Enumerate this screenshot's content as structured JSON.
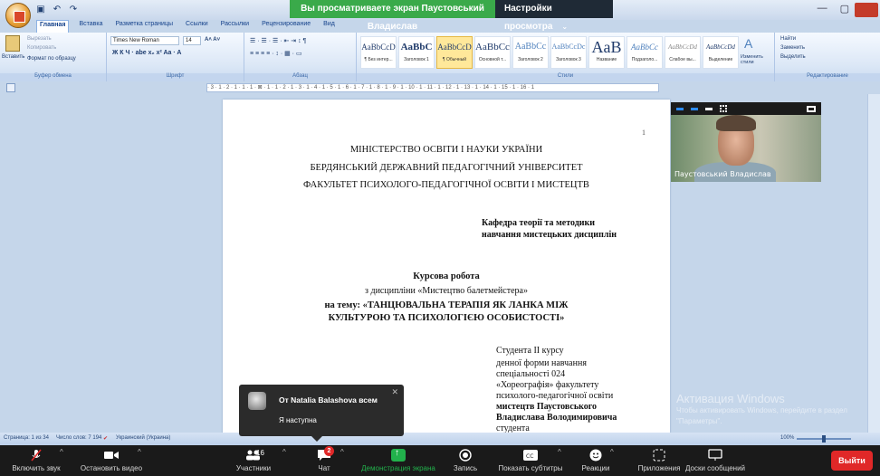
{
  "zoom_banner": {
    "sharing_text": "Вы просматриваете экран Паустовський Владислав",
    "view_options": "Настройки просмотра"
  },
  "word": {
    "qat_icons": [
      "save-icon",
      "undo-icon",
      "redo-icon"
    ],
    "tabs": [
      "Главная",
      "Вставка",
      "Разметка страницы",
      "Ссылки",
      "Рассылки",
      "Рецензирование",
      "Вид"
    ],
    "active_tab": "Главная",
    "clipboard": {
      "paste": "Вставить",
      "cut": "Вырезать",
      "copy": "Копировать",
      "format_painter": "Формат по образцу",
      "group_label": "Буфер обмена"
    },
    "font": {
      "name": "Times New Roman",
      "size": "14",
      "group_label": "Шрифт"
    },
    "paragraph": {
      "group_label": "Абзац"
    },
    "styles": {
      "group_label": "Стили",
      "items": [
        {
          "sample": "AaBbCcD",
          "name": "¶ Без интер..."
        },
        {
          "sample": "AaBbC",
          "name": "Заголовок 1"
        },
        {
          "sample": "AaBbCcD",
          "name": "¶ Обычный",
          "selected": true
        },
        {
          "sample": "AaBbCc",
          "name": "Основной т..."
        },
        {
          "sample": "AaBbCc",
          "name": "Заголовок 2"
        },
        {
          "sample": "AaBbCcDc",
          "name": "Заголовок 3"
        },
        {
          "sample": "AaB",
          "name": "Название"
        },
        {
          "sample": "AaBbCc",
          "name": "Подзаголо..."
        },
        {
          "sample": "AaBbCcDd",
          "name": "Слабое вы..."
        },
        {
          "sample": "AaBbCcDd",
          "name": "Выделение"
        }
      ],
      "change_styles": "Изменить стили"
    },
    "editing": {
      "find": "Найти",
      "replace": "Заменить",
      "select": "Выделить",
      "group_label": "Редактирование"
    },
    "ruler_text": "· 3 · 1 · 2 · 1 · 1 · 1 · ⊠ · 1 · 1 · 2 · 1 · 3 · 1 · 4 · 1 · 5 · 1 · 6 · 1 · 7 · 1 · 8 · 1 · 9 · 1 · 10 · 1 · 11 · 1 · 12 · 1 · 13 · 1 · 14 · 1 · 15 · 1 · 16 · 1",
    "statusbar": {
      "page": "Страница: 1 из 34",
      "words": "Число слов: 7 194",
      "language": "Украинский (Украина)",
      "zoom": "100%"
    }
  },
  "document": {
    "page_number": "1",
    "ministry": "МІНІСТЕРСТВО ОСВІТИ І НАУКИ УКРАЇНИ",
    "university": "БЕРДЯНСЬКИЙ ДЕРЖАВНИЙ ПЕДАГОГІЧНИЙ УНІВЕРСИТЕТ",
    "faculty": "ФАКУЛЬТЕТ ПСИХОЛОГО-ПЕДАГОГІЧНОЇ ОСВІТИ І МИСТЕЦТВ",
    "department_line1": "Кафедра теорії та методики",
    "department_line2": "навчання мистецьких дисциплін",
    "work_type": "Курсова робота",
    "discipline": "з дисципліни «Мистецтво балетмейстера»",
    "topic_line1": "на тему: «ТАНЦЮВАЛЬНА ТЕРАПІЯ ЯК ЛАНКА МІЖ",
    "topic_line2": "КУЛЬТУРОЮ ТА ПСИХОЛОГІЄЮ ОСОБИСТОСТІ»",
    "student": [
      "Студента ІІ курсу",
      "денної форми навчання",
      "спеціальності 024",
      "«Хореографія» факультету",
      "психолого-педагогічної освіти",
      "мистецтв Паустовського",
      "Владислава Володимировича",
      "студента"
    ]
  },
  "participant_video": {
    "name": "Паустовський Владислав"
  },
  "chat_popup": {
    "from": "От Natalia Balashova всем",
    "message": "Я наступна"
  },
  "watermark": {
    "title": "Активация Windows",
    "subtitle": "Чтобы активировать Windows, перейдите в раздел \"Параметры\"."
  },
  "zoom_toolbar": {
    "unmute": "Включить звук",
    "start_video": "Остановить видео",
    "participants": "Участники",
    "participants_count": "16",
    "chat": "Чат",
    "chat_badge": "2",
    "share_screen": "Демонстрация экрана",
    "record": "Запись",
    "captions": "Показать субтитры",
    "reactions": "Реакции",
    "apps": "Приложения",
    "whiteboards": "Доски сообщений",
    "leave": "Выйти"
  }
}
